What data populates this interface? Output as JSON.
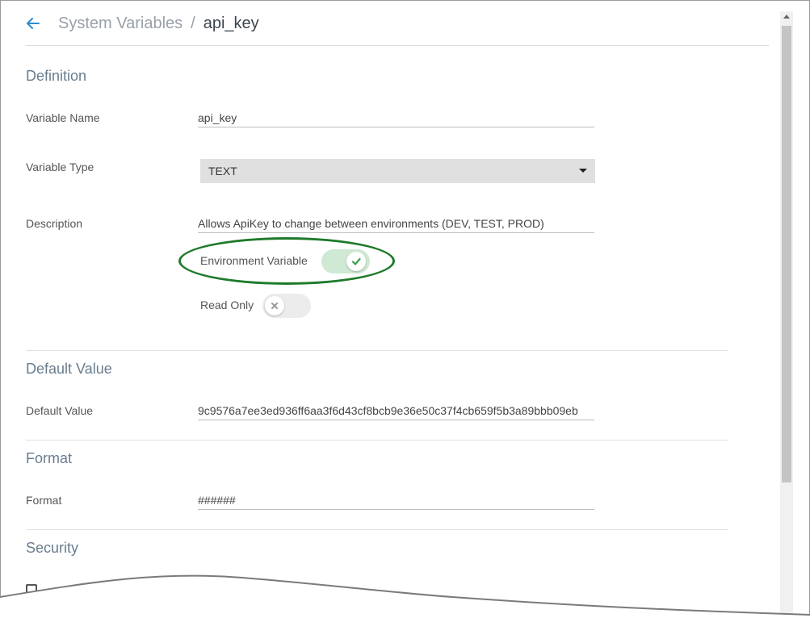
{
  "header": {
    "back_icon": "back-arrow-icon",
    "breadcrumb_parent": "System Variables",
    "breadcrumb_separator": "/",
    "breadcrumb_current": "api_key"
  },
  "definition": {
    "section_title": "Definition",
    "variable_name_label": "Variable Name",
    "variable_name_value": "api_key",
    "variable_type_label": "Variable Type",
    "variable_type_value": "TEXT",
    "description_label": "Description",
    "description_value": "Allows ApiKey to change between environments (DEV, TEST, PROD)",
    "environment_variable_label": "Environment Variable",
    "environment_variable_on": true,
    "read_only_label": "Read Only",
    "read_only_on": false
  },
  "default_value": {
    "section_title": "Default Value",
    "label": "Default Value",
    "value": "9c9576a7ee3ed936ff6aa3f6d43cf8bcb9e36e50c37f4cb659f5b3a89bbb09eb"
  },
  "format": {
    "section_title": "Format",
    "label": "Format",
    "value": "######"
  },
  "security": {
    "section_title": "Security"
  },
  "colors": {
    "accent": "#2a8ccf",
    "toggle_on": "#cfe9d4",
    "check": "#3aa04a",
    "highlight": "#1d7a2a"
  }
}
